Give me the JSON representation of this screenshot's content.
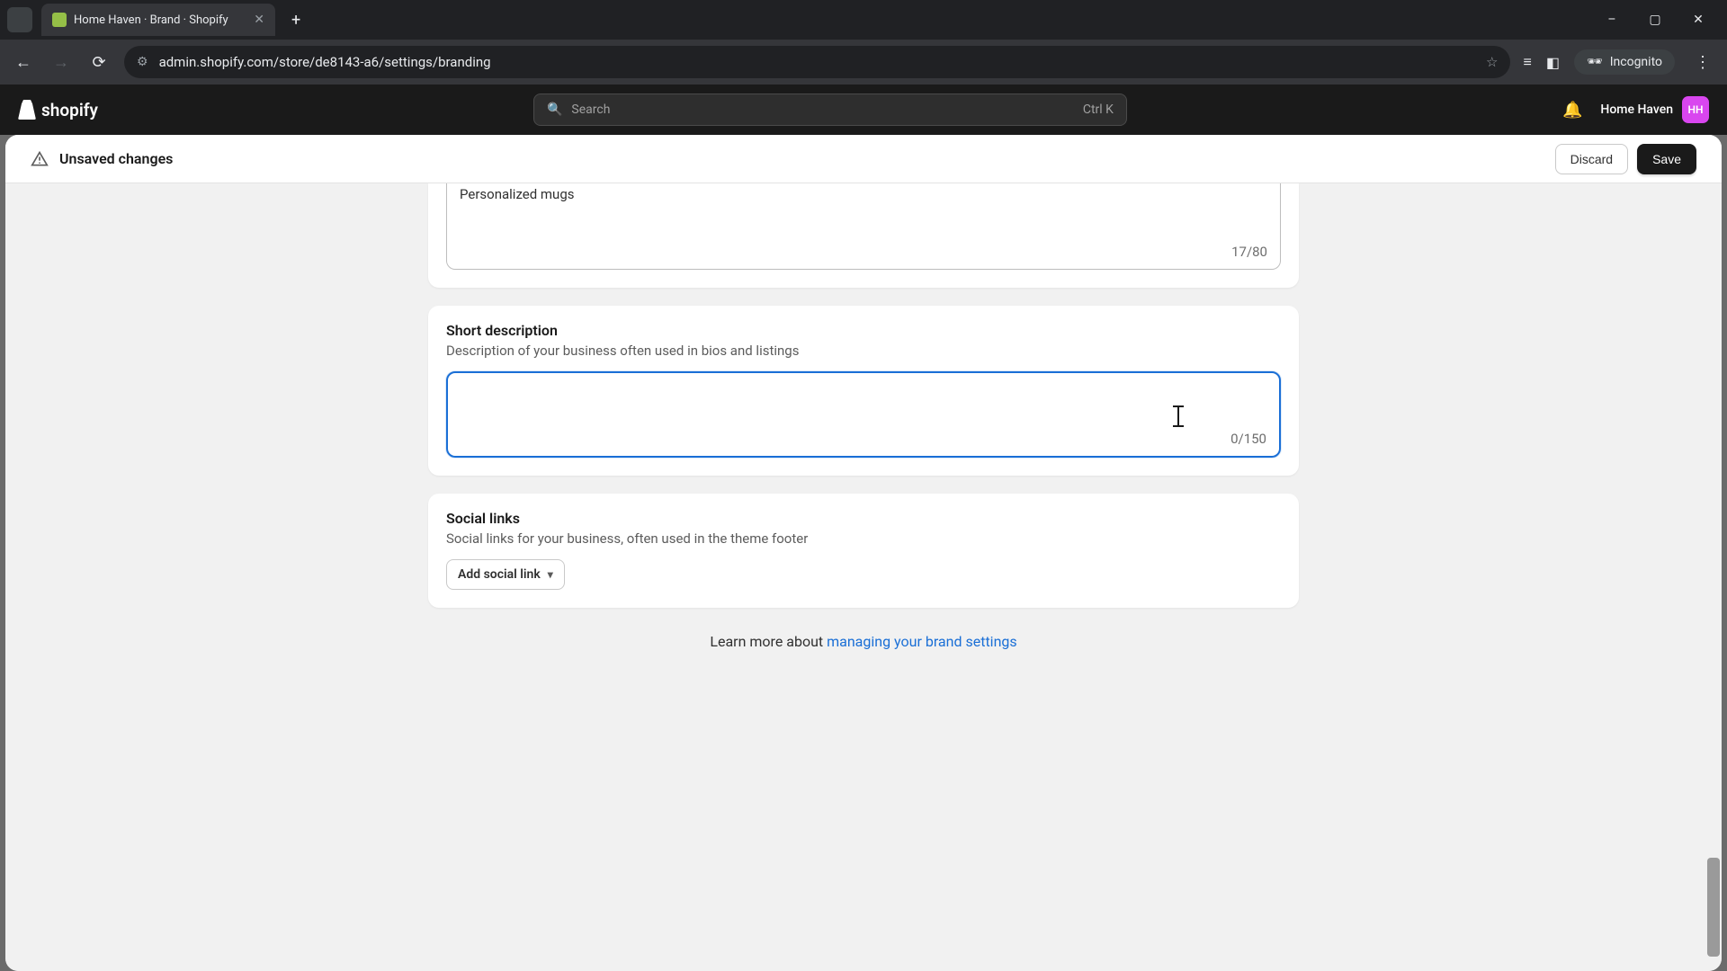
{
  "browser": {
    "tab_title": "Home Haven · Brand · Shopify",
    "url": "admin.shopify.com/store/de8143-a6/settings/branding",
    "incognito_label": "Incognito"
  },
  "header": {
    "logo_text": "shopify",
    "search_placeholder": "Search",
    "search_shortcut": "Ctrl K",
    "store_name": "Home Haven",
    "store_initials": "HH"
  },
  "save_bar": {
    "message": "Unsaved changes",
    "discard": "Discard",
    "save": "Save"
  },
  "slogan_field": {
    "value": "Personalized mugs",
    "counter": "17/80"
  },
  "short_desc": {
    "title": "Short description",
    "subtitle": "Description of your business often used in bios and listings",
    "value": "",
    "counter": "0/150"
  },
  "social": {
    "title": "Social links",
    "subtitle": "Social links for your business, often used in the theme footer",
    "add_button": "Add social link"
  },
  "footer": {
    "learn_prefix": "Learn more about ",
    "learn_link": "managing your brand settings"
  }
}
